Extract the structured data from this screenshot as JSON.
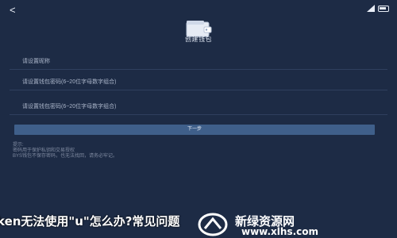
{
  "header": {
    "back_icon": "back-icon",
    "title": "创建钱包"
  },
  "form": {
    "wallet_name_placeholder": "请设置昵称",
    "password_placeholder": "请设置钱包密码(6~20位字母数字组合)",
    "password_confirm_placeholder": "请设置钱包密码(6~20位字母数字组合)"
  },
  "actions": {
    "next_label": "下一步"
  },
  "notes": {
    "title": "提示:",
    "line1": "密码用于保护私钥和交易授权",
    "line2": "BYS钱包不保存密码，也无法找回，请务必牢记。"
  },
  "overlay": {
    "caption": "ken无法使用\"u\"怎么办?常见问题"
  },
  "watermark": {
    "text": "新绿资源网",
    "url": "www.xlhs.com"
  },
  "colors": {
    "background": "#1d2b45",
    "button": "#3f5f8a"
  }
}
